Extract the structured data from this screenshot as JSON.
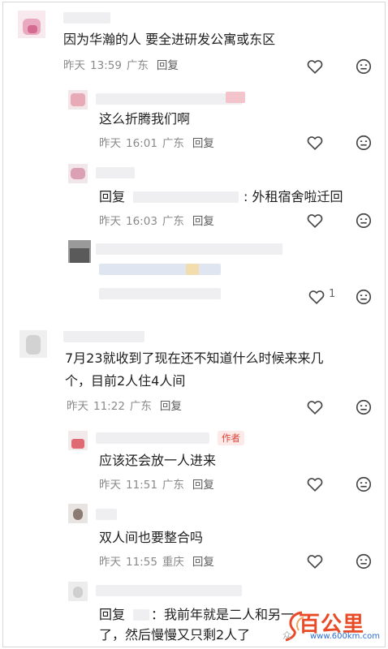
{
  "comments": [
    {
      "text": "因为华瀚的人 要全进研发公寓或东区",
      "date": "昨天",
      "time": "13:59",
      "location": "广东",
      "reply_label": "回复"
    },
    {
      "text": "这么折腾我们啊",
      "date": "昨天",
      "time": "16:01",
      "location": "广东",
      "reply_label": "回复"
    },
    {
      "reply_prefix": "回复",
      "text": ": 外租宿舍啦迁回",
      "date": "昨天",
      "time": "16:03",
      "location": "广东",
      "reply_label": "回复"
    },
    {
      "like_count": "1"
    },
    {
      "text_line1": "7月23就收到了现在还不知道什么时候来来几",
      "text_line2": "个，目前2人住4人间",
      "date": "昨天",
      "time": "11:22",
      "location": "广东",
      "reply_label": "回复"
    },
    {
      "author_tag": "作者",
      "text": "应该还会放一人进来",
      "date": "昨天",
      "time": "11:51",
      "location": "广东",
      "reply_label": "回复"
    },
    {
      "text": "双人间也要整合吗",
      "date": "昨天",
      "time": "11:55",
      "location": "重庆",
      "reply_label": "回复"
    },
    {
      "reply_prefix": "回复",
      "text_line1": "：我前年就是二人和另一",
      "text_line2": "了，然后慢慢又只剩2人了"
    }
  ],
  "watermark": {
    "logo": "百公里",
    "url": "www.600km.com",
    "wechat_mark": "众"
  },
  "colors": {
    "accent_author": "#e0463c",
    "meta_gray": "#8a8a8a",
    "watermark_orange": "#e94a27",
    "watermark_blue": "#2b6bd6"
  },
  "icons": [
    "heart-icon",
    "dislike-face-icon"
  ]
}
